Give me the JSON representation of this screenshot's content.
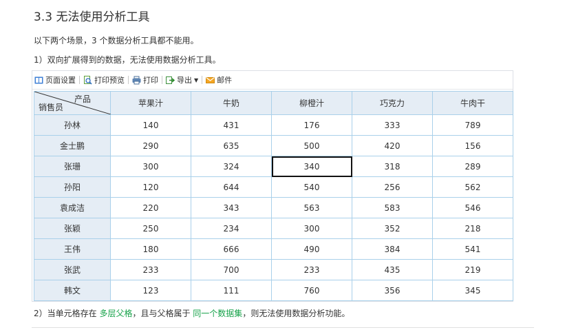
{
  "heading": "3.3 无法使用分析工具",
  "intro": "以下两个场景，3 个数据分析工具都不能用。",
  "scenario1": "1）双向扩展得到的数据，无法使用数据分析工具。",
  "toolbar": {
    "page_setup": "页面设置",
    "print_preview": "打印预览",
    "print": "打印",
    "export": "导出",
    "mail": "邮件"
  },
  "table": {
    "corner_top": "产品",
    "corner_bottom": "销售员",
    "columns": [
      "苹果汁",
      "牛奶",
      "柳橙汁",
      "巧克力",
      "牛肉干"
    ],
    "rows": [
      {
        "name": "孙林",
        "values": [
          "140",
          "431",
          "176",
          "333",
          "789"
        ]
      },
      {
        "name": "金士鹏",
        "values": [
          "290",
          "635",
          "500",
          "420",
          "156"
        ]
      },
      {
        "name": "张珊",
        "values": [
          "300",
          "324",
          "340",
          "318",
          "289"
        ]
      },
      {
        "name": "孙阳",
        "values": [
          "120",
          "644",
          "540",
          "256",
          "562"
        ]
      },
      {
        "name": "袁成洁",
        "values": [
          "220",
          "343",
          "563",
          "583",
          "546"
        ]
      },
      {
        "name": "张颖",
        "values": [
          "250",
          "234",
          "300",
          "352",
          "218"
        ]
      },
      {
        "name": "王伟",
        "values": [
          "180",
          "666",
          "490",
          "384",
          "541"
        ]
      },
      {
        "name": "张武",
        "values": [
          "233",
          "700",
          "233",
          "435",
          "219"
        ]
      },
      {
        "name": "韩文",
        "values": [
          "123",
          "111",
          "760",
          "356",
          "345"
        ]
      }
    ]
  },
  "scenario2": {
    "prefix": "2）当单元格存在 ",
    "link1": "多层父格",
    "middle": "，且与父格属于 ",
    "link2": "同一个数据集",
    "suffix": "，则无法使用数据分析功能。"
  },
  "colors": {
    "header_bg": "#e5edf5",
    "grid_border": "#a9d0ea",
    "link_green": "#17a34a"
  }
}
